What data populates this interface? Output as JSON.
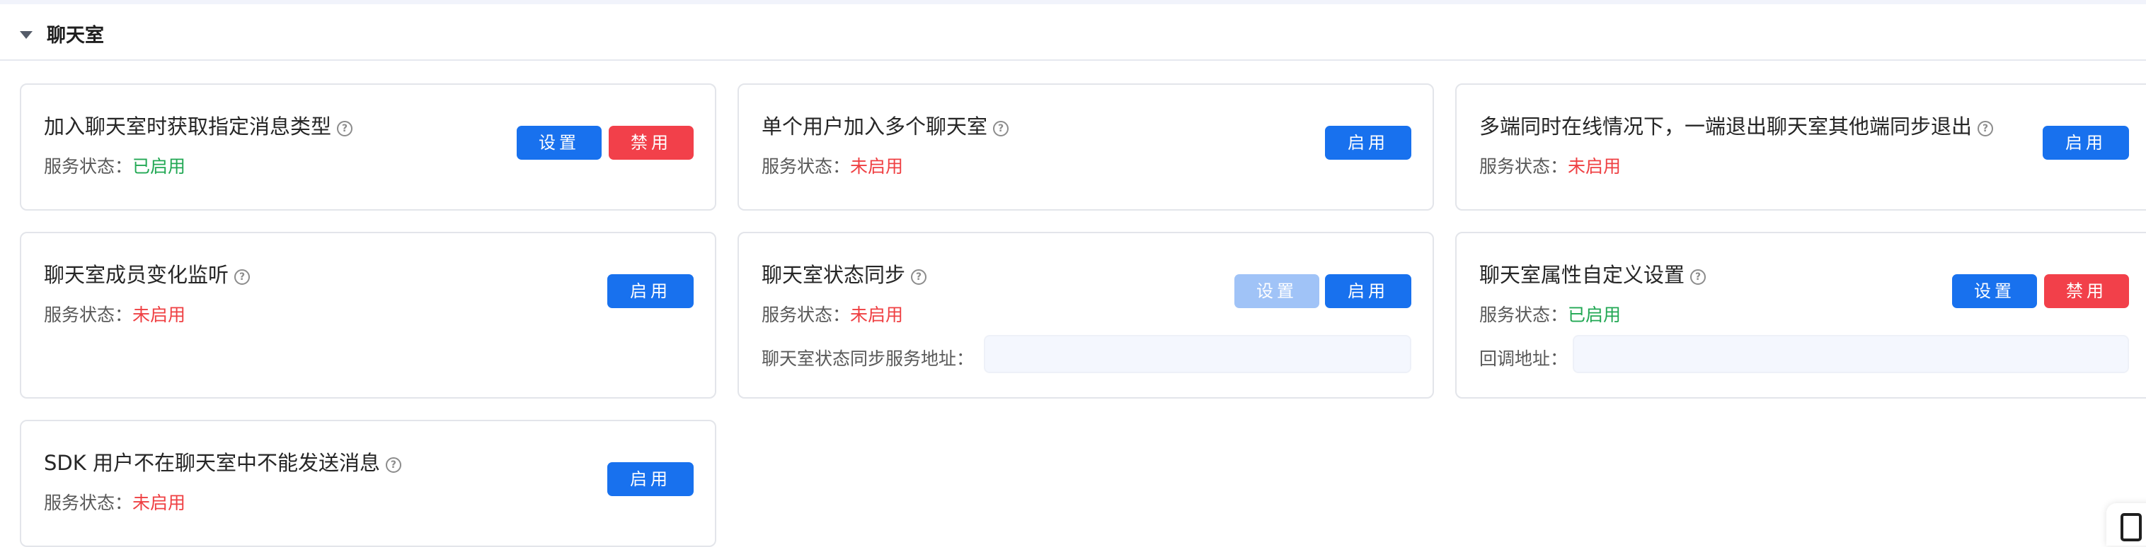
{
  "section": {
    "title": "聊天室"
  },
  "help_glyph": "?",
  "status_prefix": "服务状态：",
  "cards": [
    {
      "title": "加入聊天室时获取指定消息类型",
      "status": "已启用",
      "buttons": [
        "设置",
        "禁用"
      ]
    },
    {
      "title": "单个用户加入多个聊天室",
      "status": "未启用",
      "buttons": [
        "启用"
      ]
    },
    {
      "title": "多端同时在线情况下，一端退出聊天室其他端同步退出",
      "status": "未启用",
      "buttons": [
        "启用"
      ]
    },
    {
      "title": "聊天室成员变化监听",
      "status": "未启用",
      "buttons": [
        "启用"
      ]
    },
    {
      "title": "聊天室状态同步",
      "status": "未启用",
      "buttons": [
        "设置",
        "启用"
      ],
      "extra_label": "聊天室状态同步服务地址：",
      "extra_value": ""
    },
    {
      "title": "聊天室属性自定义设置",
      "status": "已启用",
      "buttons": [
        "设置",
        "禁用"
      ],
      "extra_label": "回调地址：",
      "extra_value": ""
    },
    {
      "title": "SDK 用户不在聊天室中不能发送消息",
      "status": "未启用",
      "buttons": [
        "启用"
      ]
    }
  ],
  "colors": {
    "primary": "#1871ee",
    "danger": "#f2404a",
    "disabled": "#a0c3f7",
    "enabled_text": "#22a854",
    "disabled_text": "#ef4043"
  },
  "icons": {
    "collapse": "caret-down-icon",
    "help": "question-circle-icon",
    "floating": "document-icon"
  }
}
